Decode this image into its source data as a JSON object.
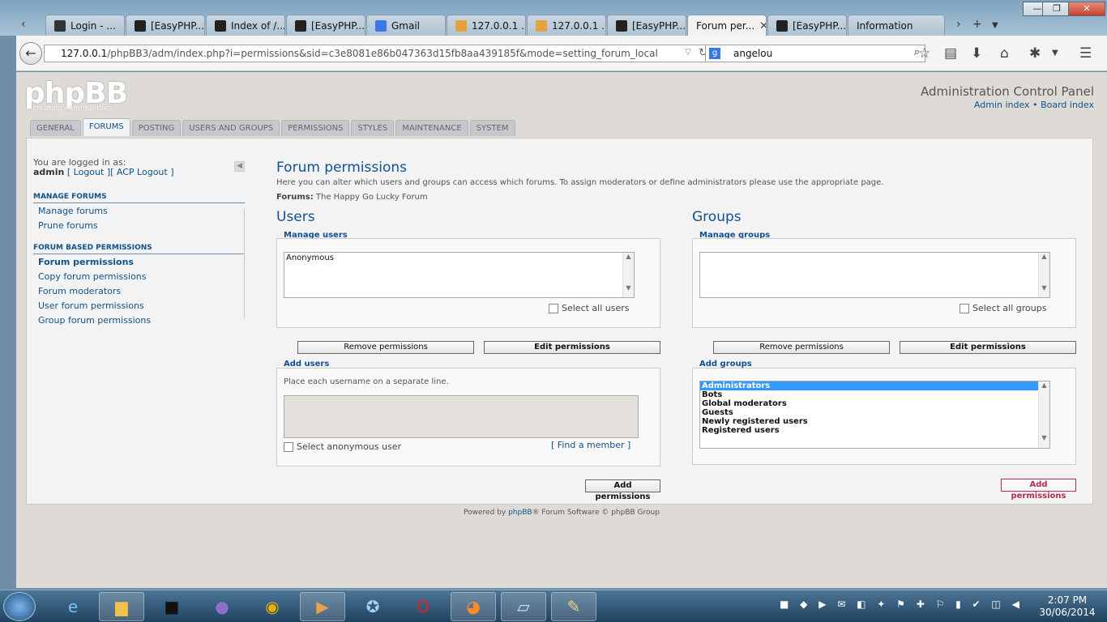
{
  "browser": {
    "tabs": [
      {
        "label": "Login - ...",
        "icon": "bookmark-icon",
        "color": "#333333"
      },
      {
        "label": "[EasyPHP...",
        "icon": "easyphp-icon",
        "color": "#222222"
      },
      {
        "label": "Index of /...",
        "icon": "easyphp-icon",
        "color": "#222222"
      },
      {
        "label": "[EasyPHP...",
        "icon": "easyphp-icon",
        "color": "#222222"
      },
      {
        "label": "Gmail",
        "icon": "google-icon",
        "color": "#3b78e7"
      },
      {
        "label": "127.0.0.1 ...",
        "icon": "phpmyadmin-icon",
        "color": "#e6a23c"
      },
      {
        "label": "127.0.0.1 ...",
        "icon": "phpmyadmin-icon",
        "color": "#e6a23c"
      },
      {
        "label": "[EasyPHP...",
        "icon": "easyphp-icon",
        "color": "#222222"
      },
      {
        "label": "Forum per...",
        "icon": "",
        "color": "",
        "active": true
      },
      {
        "label": "[EasyPHP...",
        "icon": "easyphp-icon",
        "color": "#222222"
      },
      {
        "label": "Information",
        "icon": "",
        "color": ""
      }
    ],
    "url_host": "127.0.0.1",
    "url_path": "/phpBB3/adm/index.php?i=permissions&sid=c3e8081e86b047363d15fb8aa439185f&mode=setting_forum_local",
    "search_value": "angelou"
  },
  "header": {
    "logo": "phpBB",
    "logo_tagline": "creating communities",
    "acp_title": "Administration Control Panel",
    "admin_index": "Admin index",
    "separator": "•",
    "board_index": "Board index"
  },
  "main_tabs": [
    {
      "label": "GENERAL"
    },
    {
      "label": "FORUMS",
      "active": true
    },
    {
      "label": "POSTING"
    },
    {
      "label": "USERS AND GROUPS"
    },
    {
      "label": "PERMISSIONS"
    },
    {
      "label": "STYLES"
    },
    {
      "label": "MAINTENANCE"
    },
    {
      "label": "SYSTEM"
    }
  ],
  "sidebar": {
    "logged_in_as": "You are logged in as:",
    "username": "admin",
    "logout": "[ Logout ]",
    "acp_logout": "[ ACP Logout ]",
    "section1": "MANAGE FORUMS",
    "section1_items": [
      "Manage forums",
      "Prune forums"
    ],
    "section2": "FORUM BASED PERMISSIONS",
    "section2_items": [
      "Forum permissions",
      "Copy forum permissions",
      "Forum moderators",
      "User forum permissions",
      "Group forum permissions"
    ]
  },
  "main": {
    "title": "Forum permissions",
    "intro": "Here you can alter which users and groups can access which forums. To assign moderators or define administrators please use the appropriate page.",
    "forums_label": "Forums:",
    "forums_value": "The Happy Go Lucky Forum",
    "users": {
      "heading": "Users",
      "manage_legend": "Manage users",
      "list": [
        "Anonymous"
      ],
      "select_all": "Select all users",
      "remove_btn": "Remove permissions",
      "edit_btn": "Edit permissions",
      "add_legend": "Add users",
      "add_hint": "Place each username on a separate line.",
      "select_anon": "Select anonymous user",
      "find_member": "[ Find a member ]",
      "add_btn": "Add permissions"
    },
    "groups": {
      "heading": "Groups",
      "manage_legend": "Manage groups",
      "select_all": "Select all groups",
      "remove_btn": "Remove permissions",
      "edit_btn": "Edit permissions",
      "add_legend": "Add groups",
      "list": [
        "Administrators",
        "Bots",
        "Global moderators",
        "Guests",
        "Newly registered users",
        "Registered users"
      ],
      "add_btn": "Add permissions"
    }
  },
  "footer": {
    "prefix": "Powered by",
    "brand": "phpBB",
    "suffix": "® Forum Software © phpBB Group"
  },
  "taskbar": {
    "time": "2:07 PM",
    "date": "30/06/2014"
  }
}
